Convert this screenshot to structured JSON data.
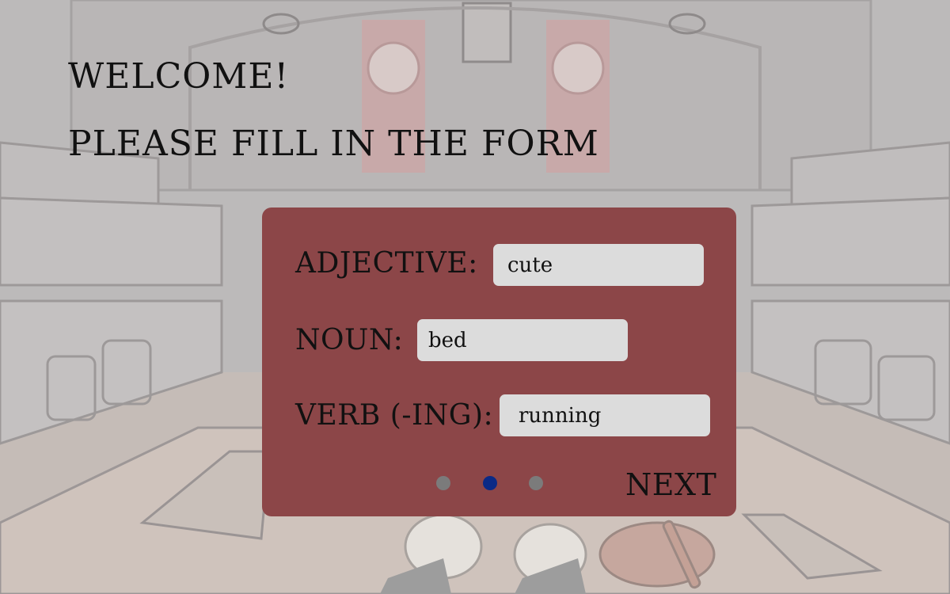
{
  "header": {
    "welcome": "WELCOME!",
    "instruction": "PLEASE FILL IN THE FORM"
  },
  "form": {
    "fields": [
      {
        "label": "ADJECTIVE:",
        "value": "cute"
      },
      {
        "label": "NOUN:",
        "value": "bed"
      },
      {
        "label": "VERB (-ING):",
        "value": "running"
      }
    ],
    "pagination": {
      "total": 3,
      "current": 2
    },
    "next_label": "NEXT"
  },
  "colors": {
    "panel": "#8c4648",
    "input_bg": "#dcdcdc",
    "dot_inactive": "#7b7b7b",
    "dot_active": "#0b2a86"
  }
}
